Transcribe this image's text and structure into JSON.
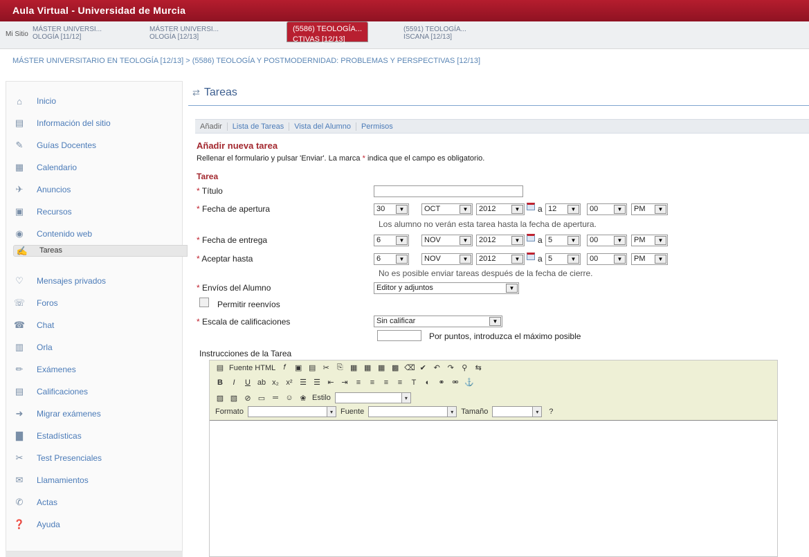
{
  "header": {
    "title": "Aula Virtual - Universidad de Murcia"
  },
  "site_tabs": {
    "first": "Mi Sitio",
    "tabs": [
      {
        "l1": "MÁSTER UNIVERSI...",
        "l2": "OLOGÍA [11/12]"
      },
      {
        "l1": "MÁSTER UNIVERSI...",
        "l2": "OLOGÍA [12/13]"
      },
      {
        "l1": "(5586) TEOLOGÍA...",
        "l2": "CTIVAS [12/13]"
      },
      {
        "l1": "(5591) TEOLOGÍA...",
        "l2": "ISCANA [12/13]"
      }
    ]
  },
  "breadcrumb": "MÁSTER UNIVERSITARIO EN TEOLOGÍA [12/13] > (5586) TEOLOGÍA Y POSTMODERNIDAD: PROBLEMAS Y PERSPECTIVAS [12/13]",
  "sidebar": {
    "items": [
      {
        "label": "Inicio",
        "icon": "home-icon"
      },
      {
        "label": "Información del sitio",
        "icon": "info-icon"
      },
      {
        "label": "Guías Docentes",
        "icon": "guide-icon"
      },
      {
        "label": "Calendario",
        "icon": "calendar-icon"
      },
      {
        "label": "Anuncios",
        "icon": "announcement-icon"
      },
      {
        "label": "Recursos",
        "icon": "resources-icon"
      },
      {
        "label": "Contenido web",
        "icon": "web-content-icon"
      },
      {
        "label": "Tareas",
        "icon": "tasks-icon"
      },
      {
        "label": "Mensajes privados",
        "icon": "messages-icon"
      },
      {
        "label": "Foros",
        "icon": "forums-icon"
      },
      {
        "label": "Chat",
        "icon": "chat-icon"
      },
      {
        "label": "Orla",
        "icon": "orla-icon"
      },
      {
        "label": "Exámenes",
        "icon": "exams-icon"
      },
      {
        "label": "Calificaciones",
        "icon": "grades-icon"
      },
      {
        "label": "Migrar exámenes",
        "icon": "migrate-icon"
      },
      {
        "label": "Estadísticas",
        "icon": "stats-icon"
      },
      {
        "label": "Test Presenciales",
        "icon": "test-icon"
      },
      {
        "label": "Llamamientos",
        "icon": "calls-icon"
      },
      {
        "label": "Actas",
        "icon": "records-icon"
      },
      {
        "label": "Ayuda",
        "icon": "help-icon"
      }
    ],
    "selected": "Tareas"
  },
  "main": {
    "title": "Tareas",
    "subtabs": [
      "Añadir",
      "Lista de Tareas",
      "Vista del Alumno",
      "Permisos"
    ],
    "form_heading": "Añadir nueva tarea",
    "instructions_pre": "Rellenar el formulario y pulsar 'Enviar'. La marca",
    "instructions_star": "*",
    "instructions_post": "indica que el campo es obligatorio.",
    "section": "Tarea",
    "fields": {
      "titulo": {
        "label": "Título",
        "value": ""
      },
      "apertura": {
        "label": "Fecha de apertura",
        "day": "30",
        "month": "OCT",
        "year": "2012",
        "hour": "12",
        "minute": "00",
        "ampm": "PM",
        "note": "Los alumno no verán esta tarea hasta la fecha de apertura."
      },
      "entrega": {
        "label": "Fecha de entrega",
        "day": "6",
        "month": "NOV",
        "year": "2012",
        "hour": "5",
        "minute": "00",
        "ampm": "PM"
      },
      "aceptar": {
        "label": "Aceptar hasta",
        "day": "6",
        "month": "NOV",
        "year": "2012",
        "hour": "5",
        "minute": "00",
        "ampm": "PM",
        "note": "No es posible enviar tareas después de la fecha de cierre."
      },
      "envios": {
        "label": "Envíos del Alumno",
        "value": "Editor y adjuntos"
      },
      "reenvios": {
        "label": "Permitir reenvíos",
        "checked": false
      },
      "escala": {
        "label": "Escala de calificaciones",
        "value": "Sin calificar",
        "points_note": "Por puntos, introduzca el máximo posible",
        "points_value": ""
      }
    },
    "separator_a": "a",
    "required_mark": "*",
    "editor": {
      "label": "Instrucciones de la Tarea",
      "source_label": "Fuente HTML",
      "style_label": "Estilo",
      "format_label": "Formato",
      "font_label": "Fuente",
      "size_label": "Tamaño",
      "content": ""
    }
  }
}
